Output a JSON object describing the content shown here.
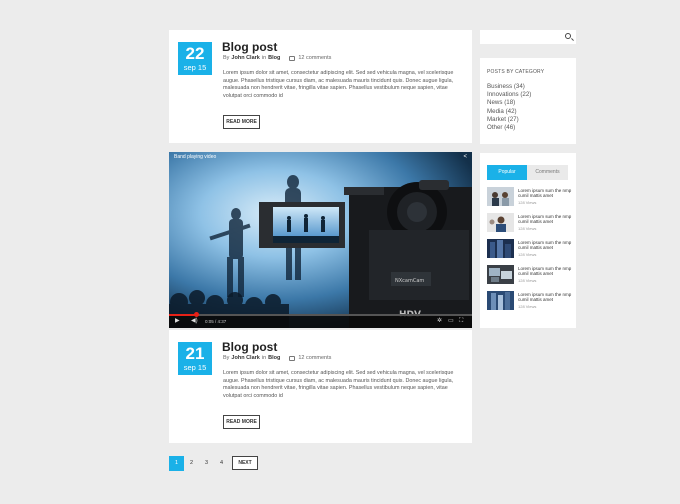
{
  "posts": [
    {
      "day": "22",
      "month": "sep 15",
      "title": "Blog post",
      "by": "By",
      "author": "John Clark",
      "in": "in",
      "category": "Blog",
      "comments": "12 comments",
      "excerpt": "Lorem ipsum dolor sit amet, consectetur adipiscing elit. Sed sed vehicula magna, vel scelerisque augue. Phasellus tristique cursus diam, ac malesuada mauris tincidunt quis. Donec augue ligula, malesuada non hendrerit vitae, fringilla vitae sapien. Phasellus vestibulum neque sapien, vitae volutpat orci commodo id",
      "read_more": "READ MORE"
    },
    {
      "day": "21",
      "month": "sep 15",
      "title": "Blog post",
      "by": "By",
      "author": "John Clark",
      "in": "in",
      "category": "Blog",
      "comments": "12 comments",
      "excerpt": "Lorem ipsum dolor sit amet, consectetur adipiscing elit. Sed sed vehicula magna, vel scelerisque augue. Phasellus tristique cursus diam, ac malesuada mauris tincidunt quis. Donec augue ligula, malesuada non hendrerit vitae, fringilla vitae sapien. Phasellus vestibulum neque sapien, vitae volutpat orci commodo id",
      "read_more": "READ MORE"
    }
  ],
  "video": {
    "title": "Band playing video",
    "time": "0:05 / 4:37",
    "progress": 0.09,
    "camera_brand": "HDV"
  },
  "search": {
    "placeholder": ""
  },
  "categories": {
    "title": "POSTS BY CATEGORY",
    "items": [
      "Business (34)",
      "Innovations (22)",
      "News (18)",
      "Media (42)",
      "Market (27)",
      "Other (46)"
    ]
  },
  "widget_tabs": {
    "popular_label": "Popular",
    "comments_label": "Comments",
    "items": [
      {
        "text": "Lorem ipsum sum the nmp cumil mattis amet",
        "views": "128 Views"
      },
      {
        "text": "Lorem ipsum sum the nmp cumil mattis amet",
        "views": "128 Views"
      },
      {
        "text": "Lorem ipsum sum the nmp cumil mattis amet",
        "views": "128 Views"
      },
      {
        "text": "Lorem ipsum sum the nmp cumil mattis amet",
        "views": "128 Views"
      },
      {
        "text": "Lorem ipsum sum the nmp cumil mattis amet",
        "views": "128 Views"
      }
    ]
  },
  "pagination": {
    "pages": [
      "1",
      "2",
      "3",
      "4"
    ],
    "active": "1",
    "next_label": "NEXT"
  },
  "colors": {
    "accent": "#1ab1e8",
    "progress": "#e62117",
    "background": "#ececec"
  }
}
